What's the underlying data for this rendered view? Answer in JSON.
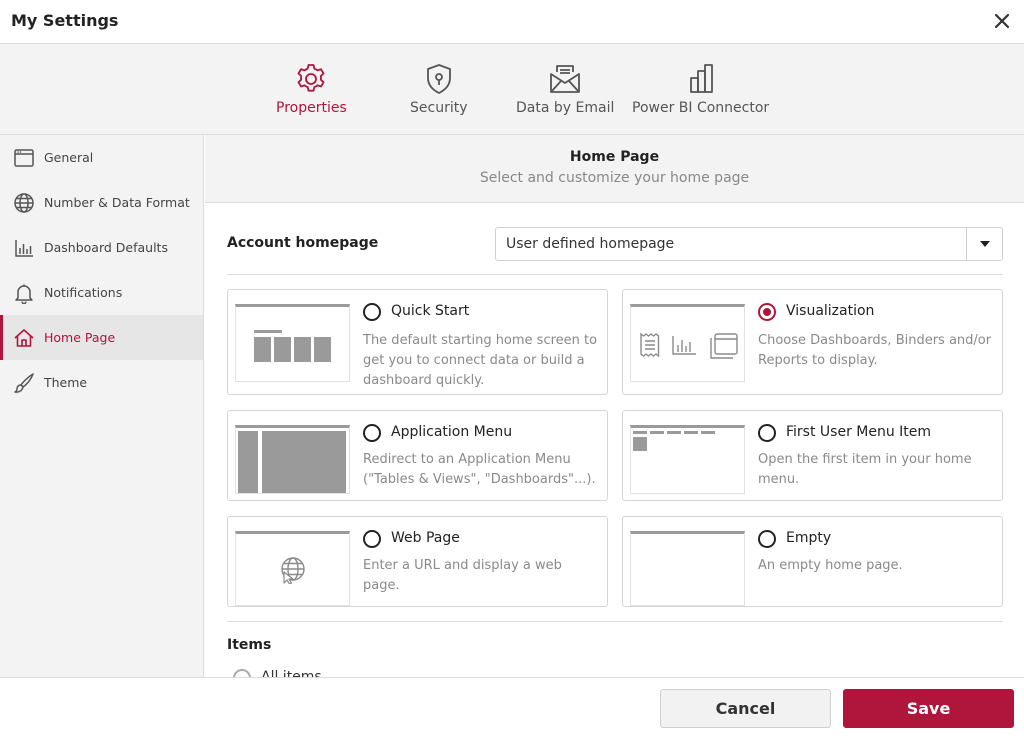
{
  "window": {
    "title": "My Settings"
  },
  "tabs": [
    {
      "label": "Properties",
      "icon": "gear-icon",
      "active": true
    },
    {
      "label": "Security",
      "icon": "shield-icon"
    },
    {
      "label": "Data by Email",
      "icon": "email-icon"
    },
    {
      "label": "Power BI Connector",
      "icon": "building-icon"
    }
  ],
  "sidebar": {
    "items": [
      {
        "label": "General",
        "icon": "window-icon"
      },
      {
        "label": "Number & Data Format",
        "icon": "globe-icon"
      },
      {
        "label": "Dashboard Defaults",
        "icon": "bar-chart-icon"
      },
      {
        "label": "Notifications",
        "icon": "bell-icon"
      },
      {
        "label": "Home Page",
        "icon": "home-icon",
        "active": true
      },
      {
        "label": "Theme",
        "icon": "brush-icon"
      }
    ]
  },
  "header": {
    "title": "Home Page",
    "subtitle": "Select and customize your home page"
  },
  "account": {
    "label": "Account homepage",
    "value": "User defined homepage"
  },
  "options": [
    {
      "title": "Quick Start",
      "desc": "The default starting home screen to get you to connect data or build a dashboard quickly.",
      "selected": false
    },
    {
      "title": "Visualization",
      "desc": "Choose Dashboards, Binders and/or Reports to display.",
      "selected": true
    },
    {
      "title": "Application Menu",
      "desc": "Redirect to an Application Menu (\"Tables & Views\", \"Dashboards\"...).",
      "selected": false
    },
    {
      "title": "First User Menu Item",
      "desc": "Open the first item in your home menu.",
      "selected": false
    },
    {
      "title": "Web Page",
      "desc": "Enter a URL and display a web page.",
      "selected": false
    },
    {
      "title": "Empty",
      "desc": "An empty home page.",
      "selected": false
    }
  ],
  "items": {
    "label": "Items",
    "first_option": "All items"
  },
  "footer": {
    "cancel_label": "Cancel",
    "save_label": "Save"
  },
  "colors": {
    "accent": "#b0153b",
    "panel": "#f3f3f3",
    "border": "#dcdcdc"
  }
}
